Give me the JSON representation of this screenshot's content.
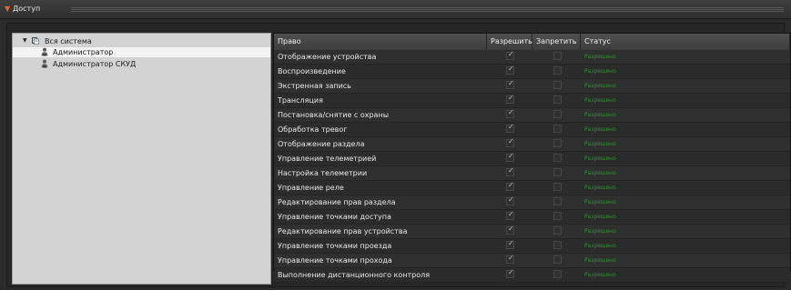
{
  "window": {
    "title": "Доступ",
    "accent": "#e06a28"
  },
  "tree": {
    "root": {
      "label": "Вся система",
      "icon": "system-icon"
    },
    "items": [
      {
        "label": "Администратор",
        "icon": "user-icon",
        "selected": true
      },
      {
        "label": "Администратор СКУД",
        "icon": "user-icon",
        "selected": false
      }
    ]
  },
  "table": {
    "columns": {
      "right": "Право",
      "allow": "Разрешить",
      "deny": "Запретить",
      "status": "Статус"
    },
    "status_color": "#2f8f2f",
    "rows": [
      {
        "name": "Отображение устройства",
        "allow": true,
        "deny": false,
        "status": "Разрешено"
      },
      {
        "name": "Воспроизведение",
        "allow": true,
        "deny": false,
        "status": "Разрешено"
      },
      {
        "name": "Экстренная запись",
        "allow": true,
        "deny": false,
        "status": "Разрешено"
      },
      {
        "name": "Трансляция",
        "allow": true,
        "deny": false,
        "status": "Разрешено"
      },
      {
        "name": "Постановка/снятие с охраны",
        "allow": true,
        "deny": false,
        "status": "Разрешено"
      },
      {
        "name": "Обработка тревог",
        "allow": true,
        "deny": false,
        "status": "Разрешено"
      },
      {
        "name": "Отображение раздела",
        "allow": true,
        "deny": false,
        "status": "Разрешено"
      },
      {
        "name": "Управление телеметрией",
        "allow": true,
        "deny": false,
        "status": "Разрешено"
      },
      {
        "name": "Настройка телеметрии",
        "allow": true,
        "deny": false,
        "status": "Разрешено"
      },
      {
        "name": "Управление реле",
        "allow": true,
        "deny": false,
        "status": "Разрешено"
      },
      {
        "name": "Редактирование прав раздела",
        "allow": true,
        "deny": false,
        "status": "Разрешено"
      },
      {
        "name": "Управление точками доступа",
        "allow": true,
        "deny": false,
        "status": "Разрешено"
      },
      {
        "name": "Редактирование прав устройства",
        "allow": true,
        "deny": false,
        "status": "Разрешено"
      },
      {
        "name": "Управление точками проезда",
        "allow": true,
        "deny": false,
        "status": "Разрешено"
      },
      {
        "name": "Управление точками прохода",
        "allow": true,
        "deny": false,
        "status": "Разрешено"
      },
      {
        "name": "Выполнение дистанционного контроля",
        "allow": true,
        "deny": false,
        "status": "Разрешено"
      }
    ]
  }
}
